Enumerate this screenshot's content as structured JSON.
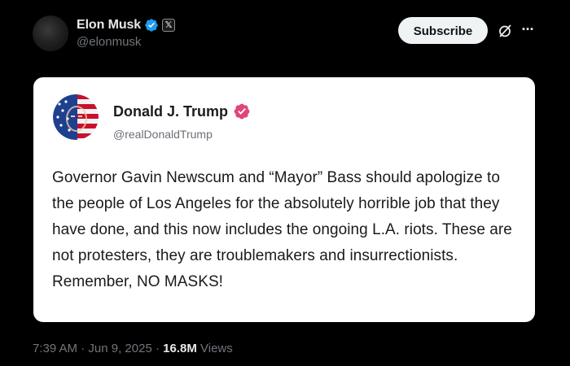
{
  "post": {
    "author_name": "Elon Musk",
    "author_handle": "@elonmusk",
    "x_badge": "𝕏",
    "subscribe_label": "Subscribe",
    "more_label": "···"
  },
  "quoted": {
    "author_name": "Donald J. Trump",
    "author_handle": "@realDonaldTrump",
    "text": "Governor Gavin Newscum and “Mayor” Bass should apologize to the people of Los Angeles for the absolutely horrible job that they have done, and this now includes the ongoing L.A. riots. These are not protesters, they are troublemakers and insurrectionists. Remember, NO MASKS!"
  },
  "meta": {
    "time": "7:39 AM",
    "separator": "·",
    "date": "Jun 9, 2025",
    "views_count": "16.8M",
    "views_label": "Views"
  },
  "icons": {
    "verified": "verified-blue-check-icon",
    "card_verified": "verified-pink-check-icon",
    "grok": "grok-icon",
    "more": "more-icon"
  },
  "colors": {
    "background": "#000000",
    "text_primary": "#e7e9ea",
    "text_secondary": "#71767b",
    "verified_blue": "#1d9bf0",
    "verified_pink": "#e0457b",
    "card_bg": "#ffffff",
    "subscribe_bg": "#eff3f4"
  }
}
